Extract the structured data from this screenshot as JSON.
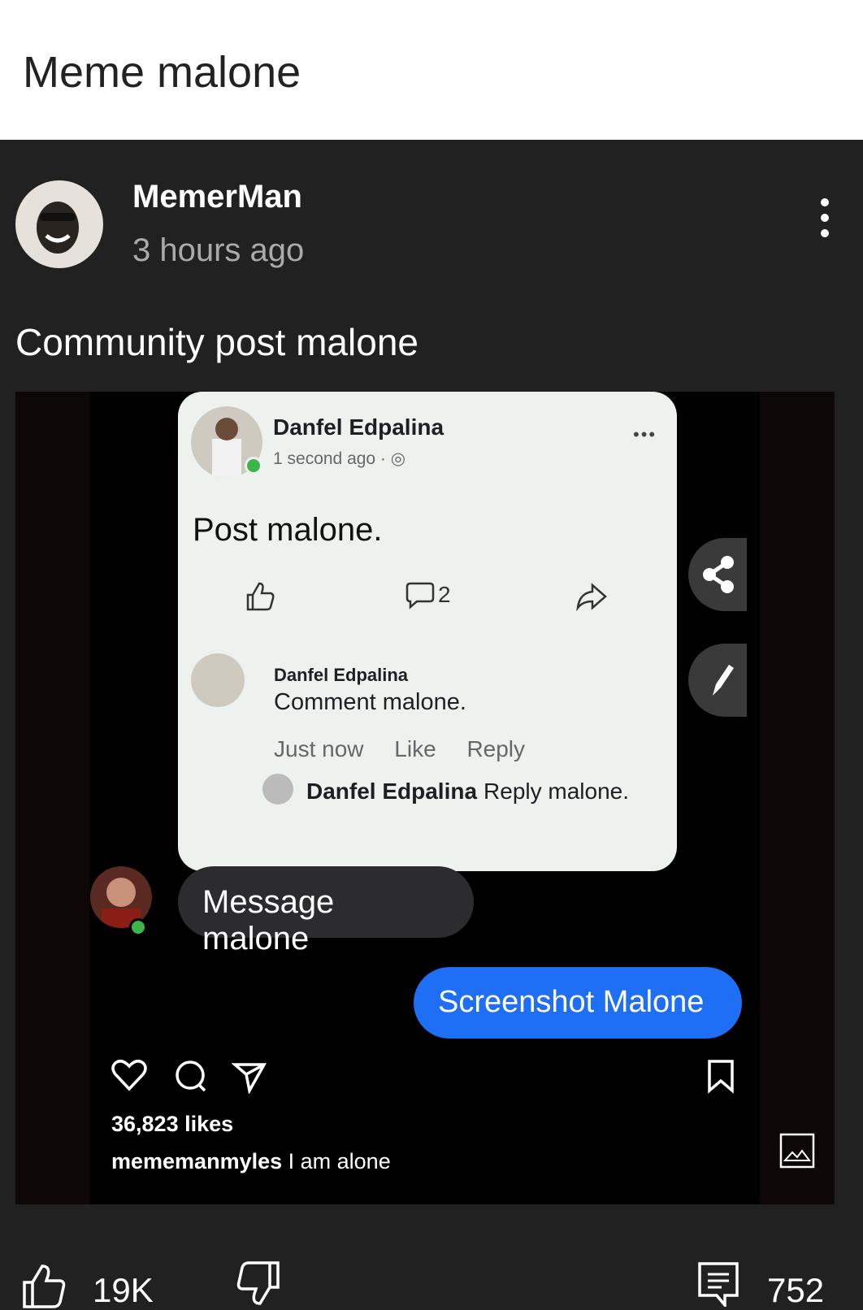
{
  "header": {
    "title": "Meme malone"
  },
  "post": {
    "author": "MemerMan",
    "time": "3 hours ago",
    "text": "Community post malone"
  },
  "meme": {
    "fb_name": "Danfel Edpalina",
    "fb_time": "1 second ago · ◎",
    "fb_post": "Post malone.",
    "fb_comment_count": "2",
    "comment_name": "Danfel Edpalina",
    "comment_text": "Comment malone.",
    "comment_time": "Just now",
    "comment_like": "Like",
    "comment_reply": "Reply",
    "reply_name": "Danfel Edpalina",
    "reply_text": "Reply malone.",
    "message_text": "Message malone",
    "screenshot_text": "Screenshot Malone",
    "ig_likes": "36,823 likes",
    "ig_user": "mememanmyles",
    "ig_caption": "I am alone"
  },
  "footer": {
    "likes": "19K",
    "comments": "752"
  },
  "colors": {
    "background": "#212121",
    "accent_blue": "#1f6ef6",
    "card": "#eef2ee"
  }
}
